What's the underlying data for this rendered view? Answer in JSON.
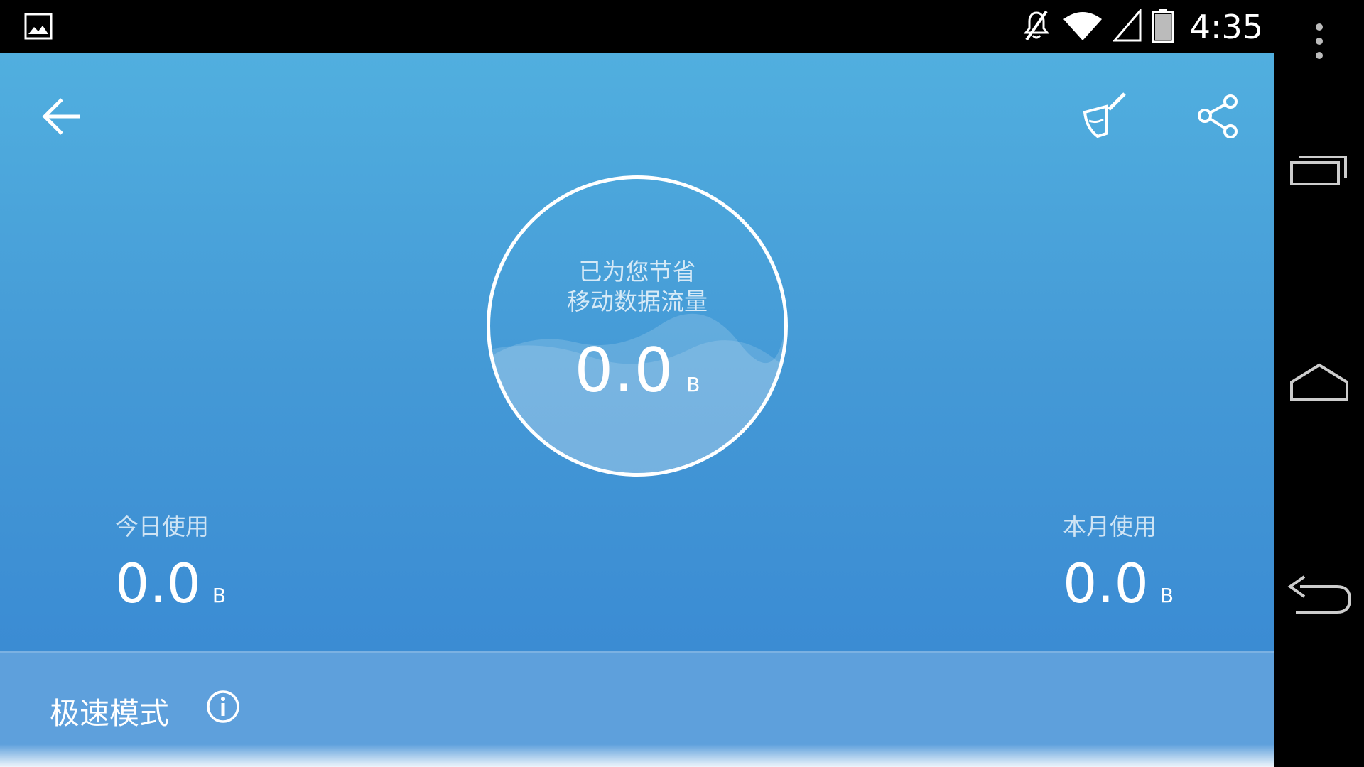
{
  "status_bar": {
    "time": "4:35",
    "icons": [
      "gallery-icon",
      "mute-icon",
      "wifi-icon",
      "signal-icon",
      "battery-icon"
    ]
  },
  "toolbar": {
    "back_icon": "arrow-left-icon",
    "clean_icon": "broom-icon",
    "share_icon": "share-icon"
  },
  "savings": {
    "title_line1": "已为您节省",
    "title_line2": "移动数据流量",
    "value": "0.0",
    "unit": "B"
  },
  "today": {
    "label": "今日使用",
    "value": "0.0",
    "unit": "B"
  },
  "month": {
    "label": "本月使用",
    "value": "0.0",
    "unit": "B"
  },
  "mode": {
    "label": "极速模式",
    "info_icon": "info-icon"
  },
  "nav": {
    "items": [
      "overflow-menu-icon",
      "recent-apps-icon",
      "home-icon",
      "back-icon"
    ]
  },
  "colors": {
    "gradient_top": "#51afdf",
    "gradient_bottom": "#3786d2",
    "panel": "#5ea0dc"
  }
}
